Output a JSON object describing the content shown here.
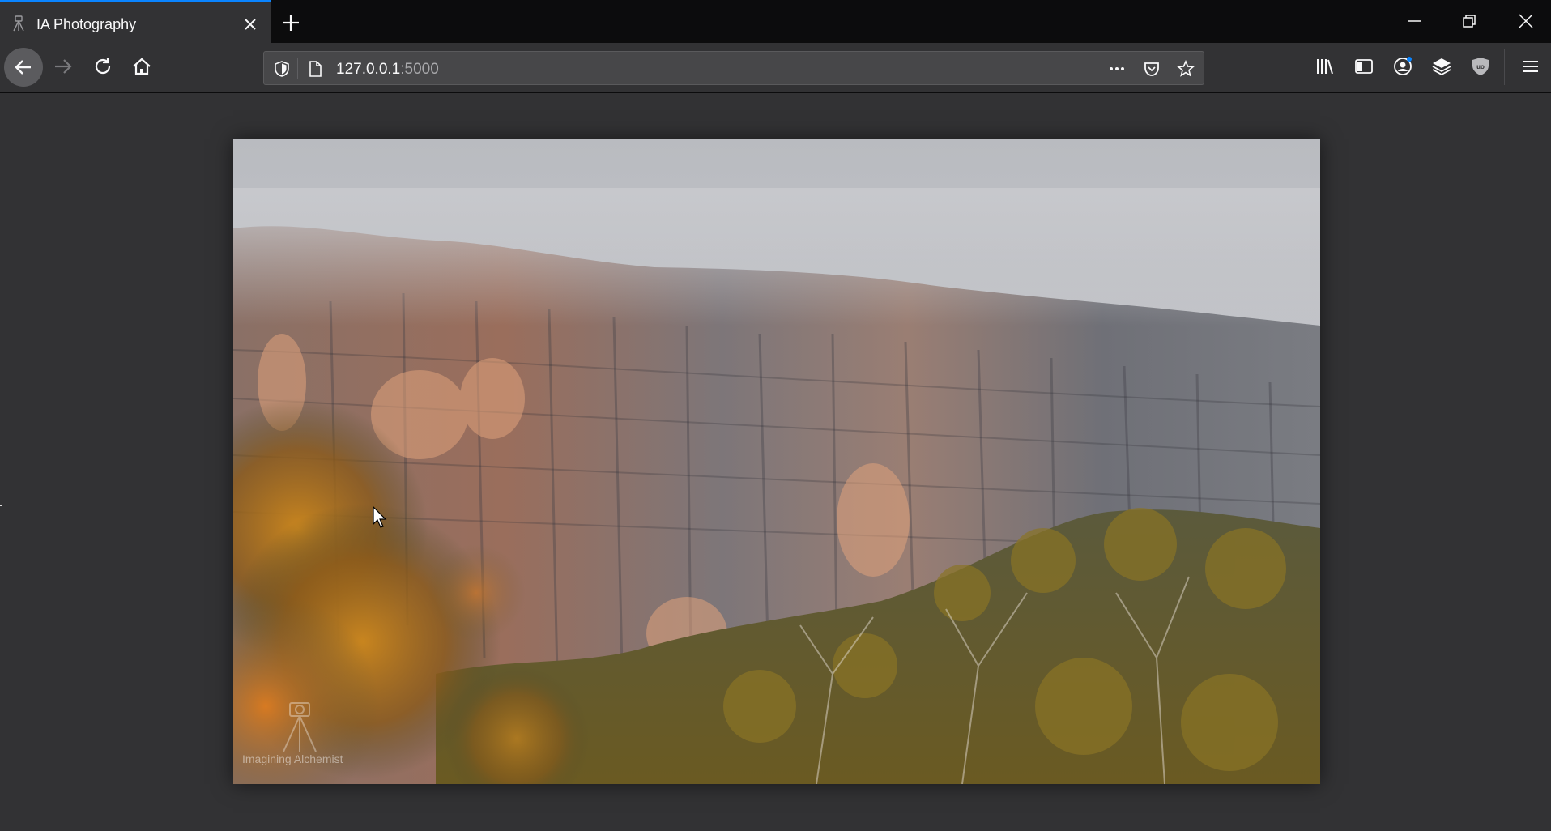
{
  "browser": {
    "tab": {
      "title": "IA Photography",
      "favicon": "tripod-camera-icon"
    },
    "accent_color": "#0a84ff",
    "url": {
      "host": "127.0.0.1",
      "port": ":5000"
    },
    "toolbar_icons": [
      "back-icon",
      "forward-icon",
      "reload-icon",
      "home-icon",
      "tracking-shield-icon",
      "page-icon",
      "more-actions-icon",
      "pocket-icon",
      "bookmark-star-icon",
      "library-icon",
      "sidebar-icon",
      "account-icon",
      "layers-icon",
      "ublock-icon",
      "hamburger-menu-icon"
    ],
    "window_controls": [
      "minimize-icon",
      "restore-icon",
      "close-icon"
    ]
  },
  "page": {
    "photo": {
      "subject": "Misty sandstone cliff face with bushland and blurred autumn foliage",
      "watermark_text": "Imagining Alchemist"
    }
  }
}
